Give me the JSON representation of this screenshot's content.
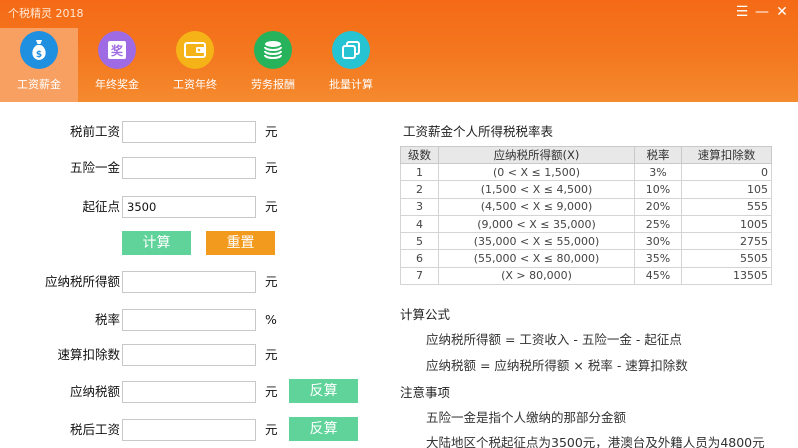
{
  "window": {
    "title": "个税精灵 2018",
    "controls": [
      "☰",
      "—",
      "✕"
    ]
  },
  "tabs": [
    {
      "label": "工资薪金",
      "icon": "money-bag-icon",
      "color": "#1f8fe0",
      "active": true
    },
    {
      "label": "年终奖金",
      "icon": "bonus-badge-icon",
      "color": "#9f6be4",
      "active": false
    },
    {
      "label": "工资年终",
      "icon": "wallet-icon",
      "color": "#f5b318",
      "active": false
    },
    {
      "label": "劳务报酬",
      "icon": "coins-stack-icon",
      "color": "#27b25c",
      "active": false
    },
    {
      "label": "批量计算",
      "icon": "copy-pages-icon",
      "color": "#26c3d2",
      "active": false
    }
  ],
  "form": {
    "pre_tax": {
      "label": "税前工资",
      "value": "",
      "unit": "元"
    },
    "insurance": {
      "label": "五险一金",
      "value": "",
      "unit": "元"
    },
    "threshold": {
      "label": "起征点",
      "value": "3500",
      "unit": "元"
    },
    "calculate_label": "计算",
    "reset_label": "重置",
    "taxable_income": {
      "label": "应纳税所得额",
      "value": "",
      "unit": "元"
    },
    "tax_rate": {
      "label": "税率",
      "value": "",
      "unit": "%"
    },
    "quick_deduction": {
      "label": "速算扣除数",
      "value": "",
      "unit": "元"
    },
    "tax_payable": {
      "label": "应纳税额",
      "value": "",
      "unit": "元",
      "reverse_label": "反算"
    },
    "after_tax": {
      "label": "税后工资",
      "value": "",
      "unit": "元",
      "reverse_label": "反算"
    }
  },
  "rate_table": {
    "title": "工资薪金个人所得税税率表",
    "headers": [
      "级数",
      "应纳税所得额(X)",
      "税率",
      "速算扣除数"
    ],
    "rows": [
      [
        "1",
        "(0 < X ≤ 1,500)",
        "3%",
        "0"
      ],
      [
        "2",
        "(1,500 < X ≤ 4,500)",
        "10%",
        "105"
      ],
      [
        "3",
        "(4,500 < X ≤ 9,000)",
        "20%",
        "555"
      ],
      [
        "4",
        "(9,000 < X ≤ 35,000)",
        "25%",
        "1005"
      ],
      [
        "5",
        "(35,000 < X ≤ 55,000)",
        "30%",
        "2755"
      ],
      [
        "6",
        "(55,000 < X ≤ 80,000)",
        "35%",
        "5505"
      ],
      [
        "7",
        "(X > 80,000)",
        "45%",
        "13505"
      ]
    ]
  },
  "formula": {
    "title": "计算公式",
    "lines": [
      "应纳税所得额 = 工资收入 - 五险一金 - 起征点",
      "应纳税额 = 应纳税所得额 × 税率 - 速算扣除数"
    ]
  },
  "notes": {
    "title": "注意事项",
    "lines": [
      "五险一金是指个人缴纳的那部分金额",
      "大陆地区个税起征点为3500元，港澳台及外籍人员为4800元"
    ]
  }
}
